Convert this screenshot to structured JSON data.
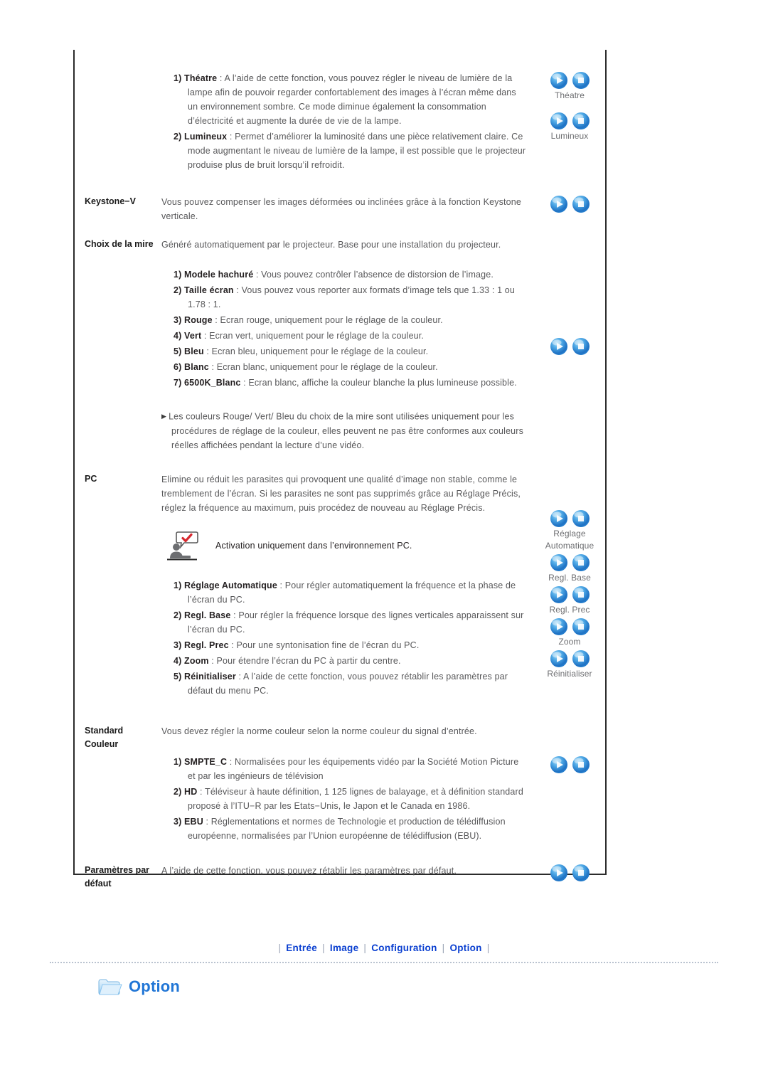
{
  "panel": {
    "sections": [
      {
        "id": "mode-lampe",
        "label": "",
        "items": [
          {
            "num": "1)",
            "term": "Théatre",
            "text": " : A l’aide de cette fonction, vous pouvez régler le niveau de lumière de la lampe afin de pouvoir regarder confortablement des images à l’écran même dans un environnement sombre. Ce mode diminue également la consommation d’électricité et augmente la durée de vie de la lampe."
          },
          {
            "num": "2)",
            "term": "Lumineux",
            "text": " : Permet d’améliorer la luminosité dans une pièce relativement claire. Ce mode augmentant le niveau de lumière de la lampe, il est possible que le projecteur produise plus de bruit lorsqu’il refroidit."
          }
        ],
        "icons": [
          {
            "caption": "Théatre"
          },
          {
            "caption": "Lumineux"
          }
        ]
      },
      {
        "id": "keystone-v",
        "label": "Keystone−V",
        "body": "Vous pouvez compenser les images déformées ou inclinées grâce à la fonction Keystone verticale.",
        "icons": [
          {
            "caption": ""
          }
        ]
      },
      {
        "id": "choix-de-la-mire",
        "label": "Choix de la mire",
        "body": "Généré automatiquement par le projecteur. Base pour une installation du projecteur.",
        "items": [
          {
            "num": "1)",
            "term": "Modele hachuré",
            "text": " : Vous pouvez contrôler l’absence de distorsion de l’image."
          },
          {
            "num": "2)",
            "term": "Taille écran",
            "text": " : Vous pouvez vous reporter aux formats d’image tels que 1.33 : 1 ou 1.78 : 1."
          },
          {
            "num": "3)",
            "term": "Rouge",
            "text": " : Ecran rouge, uniquement pour le réglage de la couleur."
          },
          {
            "num": "4)",
            "term": "Vert",
            "text": " : Ecran vert, uniquement pour le réglage de la couleur."
          },
          {
            "num": "5)",
            "term": "Bleu",
            "text": " : Ecran bleu, uniquement pour le réglage de la couleur."
          },
          {
            "num": "6)",
            "term": "Blanc",
            "text": " : Ecran blanc, uniquement pour le réglage de la couleur."
          },
          {
            "num": "7)",
            "term": "6500K_Blanc",
            "text": " : Ecran blanc, affiche la couleur blanche la plus lumineuse possible."
          }
        ],
        "note_bullet": "Les couleurs Rouge/ Vert/ Bleu du choix de la mire sont utilisées uniquement pour les procédures de réglage de la couleur, elles peuvent ne pas être conformes aux couleurs réelles affichées pendant la lecture d’une vidéo.",
        "icons": [
          {
            "caption": ""
          }
        ]
      },
      {
        "id": "pc",
        "label": "PC",
        "body": "Elimine ou réduit les parasites qui provoquent une qualité d’image non stable, comme le tremblement de l’écran. Si les parasites ne sont pas supprimés grâce au Réglage Précis, réglez la fréquence au maximum, puis procédez de nouveau au Réglage Précis.",
        "note": "Activation uniquement dans l’environnement PC.",
        "items": [
          {
            "num": "1)",
            "term": "Réglage Automatique",
            "text": " : Pour régler automatiquement la fréquence et la phase de l’écran du PC."
          },
          {
            "num": "2)",
            "term": "Regl. Base",
            "text": " : Pour régler la fréquence lorsque des lignes verticales apparaissent sur l’écran du PC."
          },
          {
            "num": "3)",
            "term": "Regl. Prec",
            "text": " : Pour une syntonisation fine de l’écran du PC."
          },
          {
            "num": "4)",
            "term": "Zoom",
            "text": " : Pour étendre l’écran du PC à partir du centre."
          },
          {
            "num": "5)",
            "term": "Réinitialiser",
            "text": " : A l’aide de cette fonction, vous pouvez rétablir les paramètres par défaut du menu PC."
          }
        ],
        "icons": [
          {
            "caption": "Réglage\nAutomatique"
          },
          {
            "caption": "Regl. Base"
          },
          {
            "caption": "Regl. Prec"
          },
          {
            "caption": "Zoom"
          },
          {
            "caption": "Réinitialiser"
          }
        ]
      },
      {
        "id": "standard-couleur",
        "label_line1": "Standard",
        "label_line2": "Couleur",
        "body": "Vous devez régler la norme couleur selon la norme couleur du signal d’entrée.",
        "items": [
          {
            "num": "1)",
            "term": "SMPTE_C",
            "text": " : Normalisées pour les équipements vidéo par la Société Motion Picture et par les ingénieurs de télévision"
          },
          {
            "num": "2)",
            "term": "HD",
            "text": " : Téléviseur à haute définition, 1 125 lignes de balayage, et à définition standard proposé à l’ITU−R par les Etats−Unis, le Japon et le Canada en 1986."
          },
          {
            "num": "3)",
            "term": "EBU",
            "text": " : Réglementations et normes de Technologie et production de télédiffusion européenne, normalisées par l’Union européenne de télédiffusion (EBU)."
          }
        ],
        "icons": [
          {
            "caption": ""
          }
        ]
      },
      {
        "id": "parametres-par-defaut",
        "label_line1": "Paramètres par",
        "label_line2": "défaut",
        "body": "A l’aide de cette fonction, vous pouvez rétablir les paramètres par défaut.",
        "icons": [
          {
            "caption": ""
          }
        ]
      }
    ]
  },
  "bottom_nav": {
    "separator": "|",
    "items": [
      {
        "label": "Entrée"
      },
      {
        "label": "Image"
      },
      {
        "label": "Configuration"
      },
      {
        "label": "Option"
      }
    ]
  },
  "footer": {
    "heading": "Option",
    "folder_icon": "folder-icon"
  },
  "icons": {
    "play_orb": "play-orb-icon",
    "stop_orb": "stop-orb-icon",
    "note": "person-check-bubble-icon",
    "bullet": "triangle-bullet-icon"
  },
  "colors": {
    "nav_link": "#0a3fd0",
    "heading": "#2176d6",
    "body_text": "#58585a",
    "term_text": "#231f20",
    "border": "#2b2b2b",
    "orb_blue": "#2e95e0"
  }
}
